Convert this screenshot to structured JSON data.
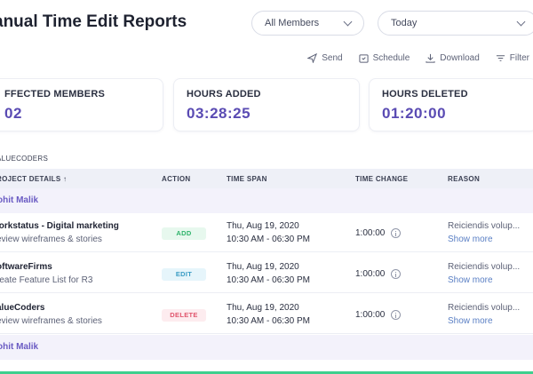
{
  "header": {
    "title": "anual Time Edit Reports",
    "members_select": "All Members",
    "date_select": "Today"
  },
  "toolbar": {
    "send": "Send",
    "schedule": "Schedule",
    "download": "Download",
    "filter": "Filter"
  },
  "summary": [
    {
      "label": "FFECTED MEMBERS",
      "value": "02"
    },
    {
      "label": "HOURS ADDED",
      "value": "03:28:25"
    },
    {
      "label": "HOURS DELETED",
      "value": "01:20:00"
    }
  ],
  "group_label": "ALUECODERS",
  "columns": {
    "project": "ROJECT DETAILS ↑",
    "action": "ACTION",
    "time_span": "TIME SPAN",
    "time_change": "TIME CHANGE",
    "reason": "REASON"
  },
  "members": [
    "ohit Malik",
    "ohit Malik"
  ],
  "rows": [
    {
      "project": "/orkstatus - Digital marketing",
      "task": "eview wireframes & stories",
      "action": "ADD",
      "date": "Thu, Aug 19, 2020",
      "time": "10:30 AM - 06:30 PM",
      "change": "1:00:00",
      "reason": "Reiciendis volup...",
      "more": "Show more"
    },
    {
      "project": "oftwareFirms",
      "task": "reate Feature List for R3",
      "action": "EDIT",
      "date": "Thu, Aug 19, 2020",
      "time": "10:30 AM - 06:30 PM",
      "change": "1:00:00",
      "reason": "Reiciendis volup...",
      "more": "Show more"
    },
    {
      "project": "alueCoders",
      "task": "eview wireframes & stories",
      "action": "DELETE",
      "date": "Thu, Aug 19, 2020",
      "time": "10:30 AM - 06:30 PM",
      "change": "1:00:00",
      "reason": "Reiciendis volup...",
      "more": "Show more"
    }
  ],
  "colors": {
    "accent": "#5a4bb3",
    "add": "#2fb36b",
    "edit": "#3a9cc4",
    "delete": "#e0566e"
  }
}
